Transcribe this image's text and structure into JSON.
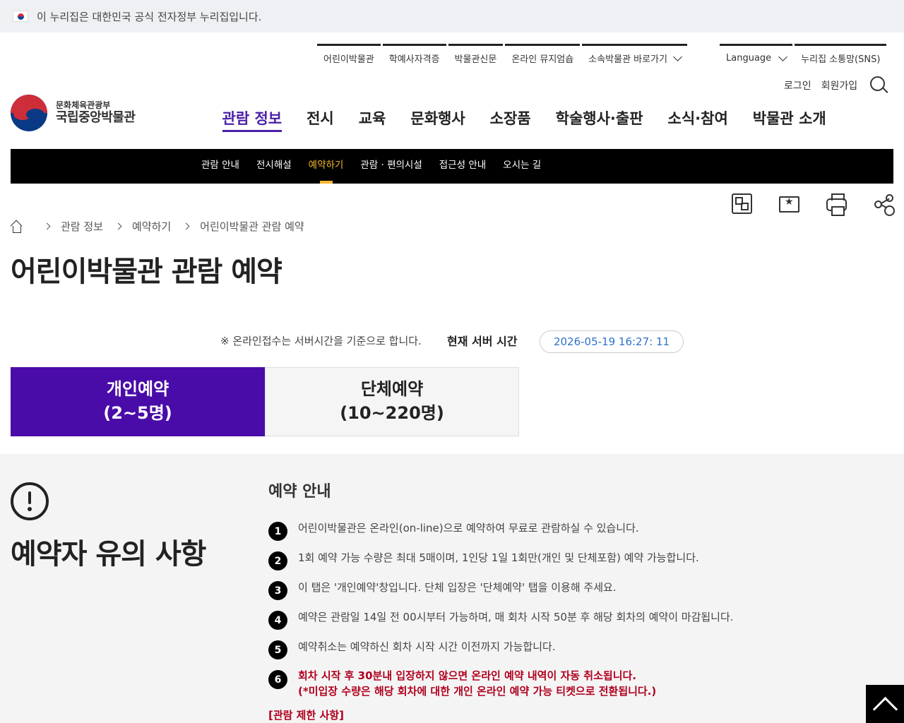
{
  "gov_banner": {
    "text": "이 누리집은 대한민국 공식 전자정부 누리집입니다."
  },
  "util_nav": {
    "items": [
      "어린이박물관",
      "학예사자격증",
      "박물관신문",
      "온라인 뮤지엄숍",
      "소속박물관 바로가기"
    ],
    "language": "Language",
    "sns": "누리집 소통망(SNS)"
  },
  "member": {
    "login": "로그인",
    "join": "회원가입"
  },
  "logo": {
    "ministry": "문화체육관광부",
    "museum": "국립중앙박물관"
  },
  "gnb": [
    "관람 정보",
    "전시",
    "교육",
    "문화행사",
    "소장품",
    "학술행사·출판",
    "소식·참여",
    "박물관 소개"
  ],
  "subnav": [
    "관람 안내",
    "전시해설",
    "예약하기",
    "관람 · 편의시설",
    "접근성 안내",
    "오시는 길"
  ],
  "breadcrumb": [
    "관람 정보",
    "예약하기",
    "어린이박물관 관람 예약"
  ],
  "page_title": "어린이박물관 관람 예약",
  "server": {
    "note": "※ 온라인접수는 서버시간을 기준으로 합니다.",
    "label": "현재 서버 시간",
    "time": "2026-05-19 16:27: 11"
  },
  "tabs": {
    "individual": {
      "line1": "개인예약",
      "line2": "(2~5명)"
    },
    "group": {
      "line1": "단체예약",
      "line2": "(10~220명)"
    }
  },
  "notice": {
    "title": "예약자 유의 사항",
    "heading": "예약 안내",
    "items": [
      {
        "num": "1",
        "text": "어린이박물관은 온라인(on-line)으로 예약하여 무료로 관람하실 수 있습니다."
      },
      {
        "num": "2",
        "text": "1회 예약 가능 수량은 최대 5매이며, 1인당 1일 1회만(개인 및 단체포함) 예약 가능합니다."
      },
      {
        "num": "3",
        "text": "이 탭은 '개인예약'창입니다. 단체 입장은 '단체예약' 탭을 이용해 주세요."
      },
      {
        "num": "4",
        "text": "예약은 관람일 14일 전 00시부터 가능하며, 매 회차 시작 50분 후 해당 회차의 예약이 마감됩니다."
      },
      {
        "num": "5",
        "text": "예약취소는 예약하신 회차 시작 시간 이전까지 가능합니다."
      },
      {
        "num": "6",
        "line1": "회차 시작 후 30분내 입장하지 않으면 온라인 예약 내역이 자동 취소됩니다.",
        "line2": "(*미입장 수량은 해당 회차에 대한 개인 온라인 예약 가능 티켓으로 전환됩니다.)"
      }
    ],
    "restriction": "[관람 제한 사항]"
  },
  "colors": {
    "accent": "#4a0ca8",
    "highlight": "#f5b82e",
    "warning": "#b0001e",
    "time": "#2c72c8"
  }
}
